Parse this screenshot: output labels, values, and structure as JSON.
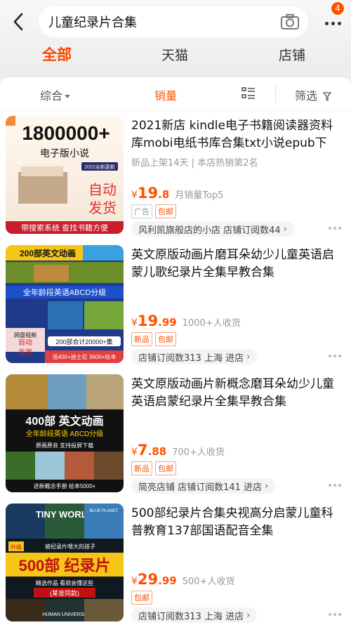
{
  "header": {
    "search_query": "儿童纪录片合集",
    "notification_count": "4"
  },
  "tabs": [
    {
      "label": "全部"
    },
    {
      "label": "天猫"
    },
    {
      "label": "店铺"
    }
  ],
  "sort": {
    "comprehensive": "综合",
    "sales": "销量",
    "filter": "筛选"
  },
  "products": [
    {
      "title": "2021新店 kindle电子书籍阅读器资料库mobi电纸书库合集txt小说epub下",
      "meta": "新品上架14天 | 本店热销第2名",
      "price_int": "19",
      "price_dec": ".8",
      "sales": "月销量Top5",
      "tags": [
        "广告",
        "包邮"
      ],
      "shop": "风利凯旗般店的小店  店铺订阅数44",
      "thumb_text": {
        "big": "1800000+",
        "sub": "电子版小说",
        "side": "自动\n发货",
        "foot": "带搜索系统 查找书籍方便",
        "tag": "2022全新更新"
      }
    },
    {
      "title": "英文原版动画片磨耳朵幼少儿童英语启蒙儿歌纪录片全集早教合集",
      "price_int": "19",
      "price_dec": ".99",
      "sales": "1000+人收货",
      "tags": [
        "新品",
        "包邮"
      ],
      "shop": "店铺订阅数313  上海  进店",
      "thumb_text": {
        "top": "200部英文动画",
        "band": "全年龄段英语ABCD分级",
        "side": "网盘视频\n自动\n发货",
        "foot1": "200部合计20000+集",
        "foot2": "送400+迪士尼 3600+绘本"
      }
    },
    {
      "title": "英文原版动画片新概念磨耳朵幼少儿童英语启蒙纪录片全集早教合集",
      "price_int": "7",
      "price_dec": ".88",
      "sales": "700+人收货",
      "tags": [
        "新品",
        "包邮"
      ],
      "shop": "简亮店铺  店铺订阅数141  进店",
      "thumb_text": {
        "big": "400部 英文动画",
        "sub": "全年龄段英语 ABCD分级",
        "note": "原画原音 支持投屏下载",
        "foot": "送新概念手册 绘本5000+"
      }
    },
    {
      "title": "500部纪录片合集央视高分启蒙儿童科普教育137部国语配音全集",
      "price_int": "29",
      "price_dec": ".99",
      "sales": "500+人收货",
      "tags": [
        "包邮"
      ],
      "shop": "店铺订阅数313  上海  进店",
      "thumb_text": {
        "tiny": "TINY WORLD",
        "blue": "BLUE PLANET",
        "small": "被纪录片喂大的孩子",
        "big": "500部 纪录片",
        "sub": "精选作品 看就会懂这些",
        "box": "(某音同款)",
        "human": "HUMAN UNIVERSE",
        "up": "升级"
      }
    }
  ],
  "colors": {
    "accent": "#ff5000"
  }
}
